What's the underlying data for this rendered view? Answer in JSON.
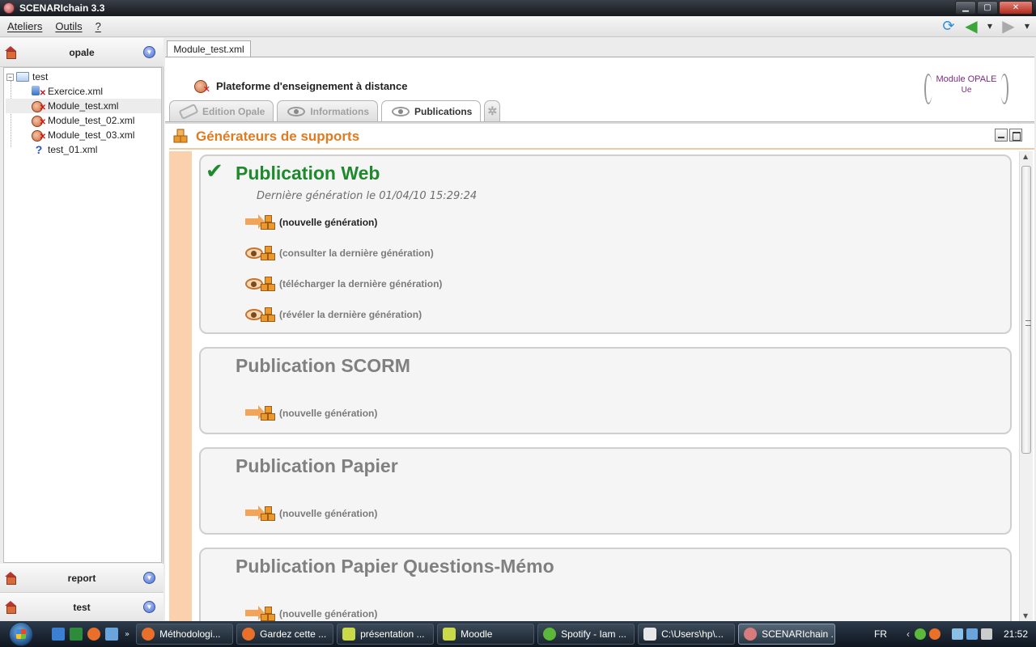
{
  "app": {
    "title": "SCENARIchain 3.3",
    "window_buttons": [
      "minimize",
      "maximize",
      "close"
    ]
  },
  "menu": {
    "items": [
      "Ateliers",
      "Outils",
      "?"
    ]
  },
  "toolbar": {
    "icons": [
      "refresh-icon",
      "back-arrow-icon",
      "dropdown-icon",
      "forward-arrow-icon",
      "dropdown-icon"
    ]
  },
  "sidebar": {
    "workshop_top": "opale",
    "tree": {
      "root": "test",
      "items": [
        {
          "label": "Exercice.xml",
          "icon": "exercise-file-icon"
        },
        {
          "label": "Module_test.xml",
          "icon": "module-file-icon",
          "selected": true
        },
        {
          "label": "Module_test_02.xml",
          "icon": "module-file-icon"
        },
        {
          "label": "Module_test_03.xml",
          "icon": "module-file-icon"
        },
        {
          "label": "test_01.xml",
          "icon": "unknown-file-icon"
        }
      ]
    },
    "workshops_bottom": [
      "report",
      "test"
    ]
  },
  "editor": {
    "doc_tab": "Module_test.xml",
    "doc_title": "Plateforme d'enseignement à distance",
    "model_badge": {
      "line1": "Module OPALE",
      "line2": "Ue"
    },
    "view_tabs": [
      {
        "label": "Edition Opale",
        "active": false
      },
      {
        "label": "Informations",
        "active": false
      },
      {
        "label": "Publications",
        "active": true
      }
    ],
    "panel_title": "Générateurs de supports",
    "publications": [
      {
        "name": "Publication Web",
        "generated": true,
        "last_generation": "Dernière génération le 01/04/10 15:29:24",
        "actions": [
          "(nouvelle génération)",
          "(consulter la dernière génération)",
          "(télécharger la dernière génération)",
          "(révéler la dernière génération)"
        ]
      },
      {
        "name": "Publication SCORM",
        "generated": false,
        "actions": [
          "(nouvelle génération)"
        ]
      },
      {
        "name": "Publication Papier",
        "generated": false,
        "actions": [
          "(nouvelle génération)"
        ]
      },
      {
        "name": "Publication Papier Questions-Mémo",
        "generated": false,
        "actions": [
          "(nouvelle génération)"
        ]
      }
    ]
  },
  "taskbar": {
    "tasks": [
      "Méthodologi...",
      "Gardez cette ...",
      "présentation ...",
      "Moodle",
      "Spotify - Iam ...",
      "C:\\Users\\hp\\...",
      "SCENARIchain ..."
    ],
    "active_task_index": 6,
    "language": "FR",
    "clock": "21:52"
  },
  "colors": {
    "accent_orange": "#e07b1f",
    "generated_green": "#1e8a2d"
  }
}
